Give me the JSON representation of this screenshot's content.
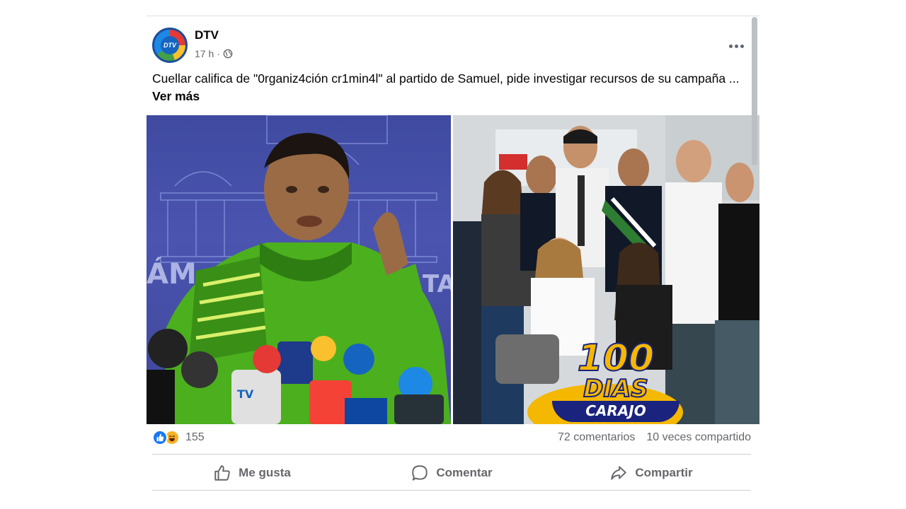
{
  "post": {
    "page_name": "DTV",
    "avatar_text": "DTV",
    "time": "17 h",
    "separator": "·",
    "privacy_icon": "globe-icon",
    "more_icon": "more-horizontal-icon",
    "text": "Cuellar califica de \"0rganiz4ción cr1min4l\" al partido de Samuel, pide investigar recursos de su campaña ... ",
    "see_more": "Ver más"
  },
  "photos": {
    "right_overlay": {
      "line1": "100",
      "line2": "DIAS",
      "line3": "CARAJO"
    }
  },
  "stats": {
    "reaction_icons": [
      "like-icon",
      "haha-icon"
    ],
    "reaction_count": "155",
    "comments": "72 comentarios",
    "shares": "10 veces compartido"
  },
  "actions": {
    "like": "Me gusta",
    "comment": "Comentar",
    "share": "Compartir"
  },
  "colors": {
    "like_blue": "#1877f2",
    "haha_yellow": "#f7b125",
    "secondary_text": "#65676b",
    "divider": "#ced0d4"
  }
}
